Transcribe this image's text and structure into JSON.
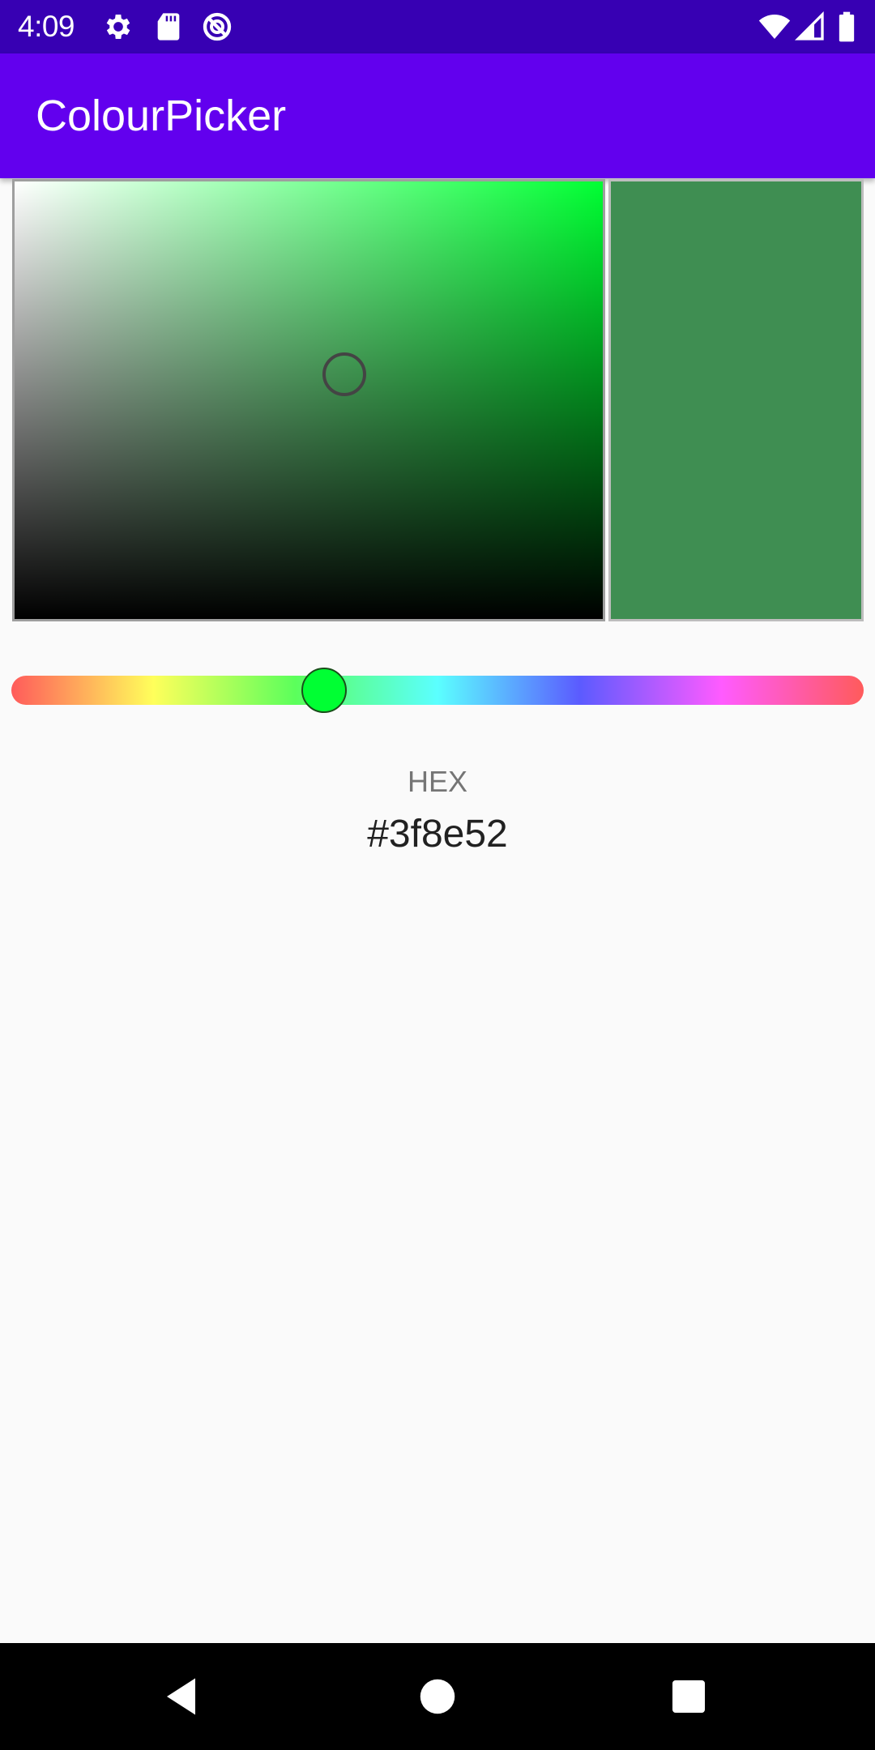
{
  "status_bar": {
    "time": "4:09",
    "left_icons": [
      "gear-icon",
      "sd-card-icon",
      "no-entry-circle-icon"
    ],
    "right_icons": [
      "wifi-icon",
      "cell-signal-icon",
      "battery-icon"
    ]
  },
  "app_bar": {
    "title": "ColourPicker"
  },
  "picker": {
    "base_hue_color": "#00ff33",
    "selected_color": "#3f8e52",
    "thumb_color": "#00ff33",
    "saturation": 0.56,
    "value": 0.56,
    "hue_degrees": 134
  },
  "hex": {
    "label": "HEX",
    "value": "#3f8e52"
  },
  "nav_bar": {
    "buttons": [
      "back-icon",
      "home-icon",
      "recents-icon"
    ]
  }
}
